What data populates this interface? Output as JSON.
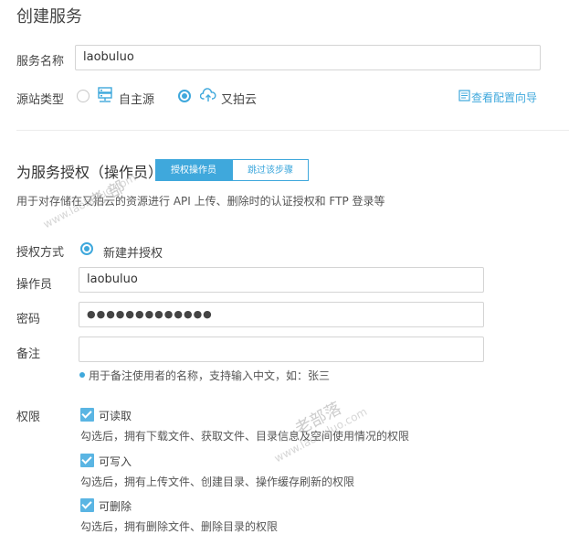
{
  "page_title": "创建服务",
  "service_name": {
    "label": "服务名称",
    "value": "laobuluo"
  },
  "source_type": {
    "label": "源站类型",
    "options": [
      {
        "label": "自主源",
        "selected": false,
        "icon": "server-icon"
      },
      {
        "label": "又拍云",
        "selected": true,
        "icon": "cloud-upload-icon"
      }
    ],
    "guide_link": "查看配置向导"
  },
  "auth": {
    "title": "为服务授权（操作员）",
    "primary_button": "授权操作员",
    "skip_button": "跳过该步骤",
    "description": "用于对存储在又拍云的资源进行 API 上传、删除时的认证授权和 FTP 登录等",
    "method_label": "授权方式",
    "method_option": "新建并授权",
    "operator_label": "操作员",
    "operator_value": "laobuluo",
    "password_label": "密码",
    "password_value": "●●●●●●●●●●●●●",
    "note_label": "备注",
    "note_value": "",
    "note_hint": "用于备注使用者的名称，支持输入中文，如：张三",
    "perm_label": "权限",
    "permissions": [
      {
        "label": "可读取",
        "checked": true,
        "desc": "勾选后，拥有下载文件、获取文件、目录信息及空间使用情况的权限"
      },
      {
        "label": "可写入",
        "checked": true,
        "desc": "勾选后，拥有上传文件、创建目录、操作缓存刷新的权限"
      },
      {
        "label": "可删除",
        "checked": true,
        "desc": "勾选后，拥有删除文件、删除目录的权限"
      }
    ]
  },
  "watermarks": {
    "w1_big": "老 部",
    "w1_small": "www.laobuluo.com",
    "w2_big": "老部落",
    "w2_small": "www.laobuluo.com"
  }
}
